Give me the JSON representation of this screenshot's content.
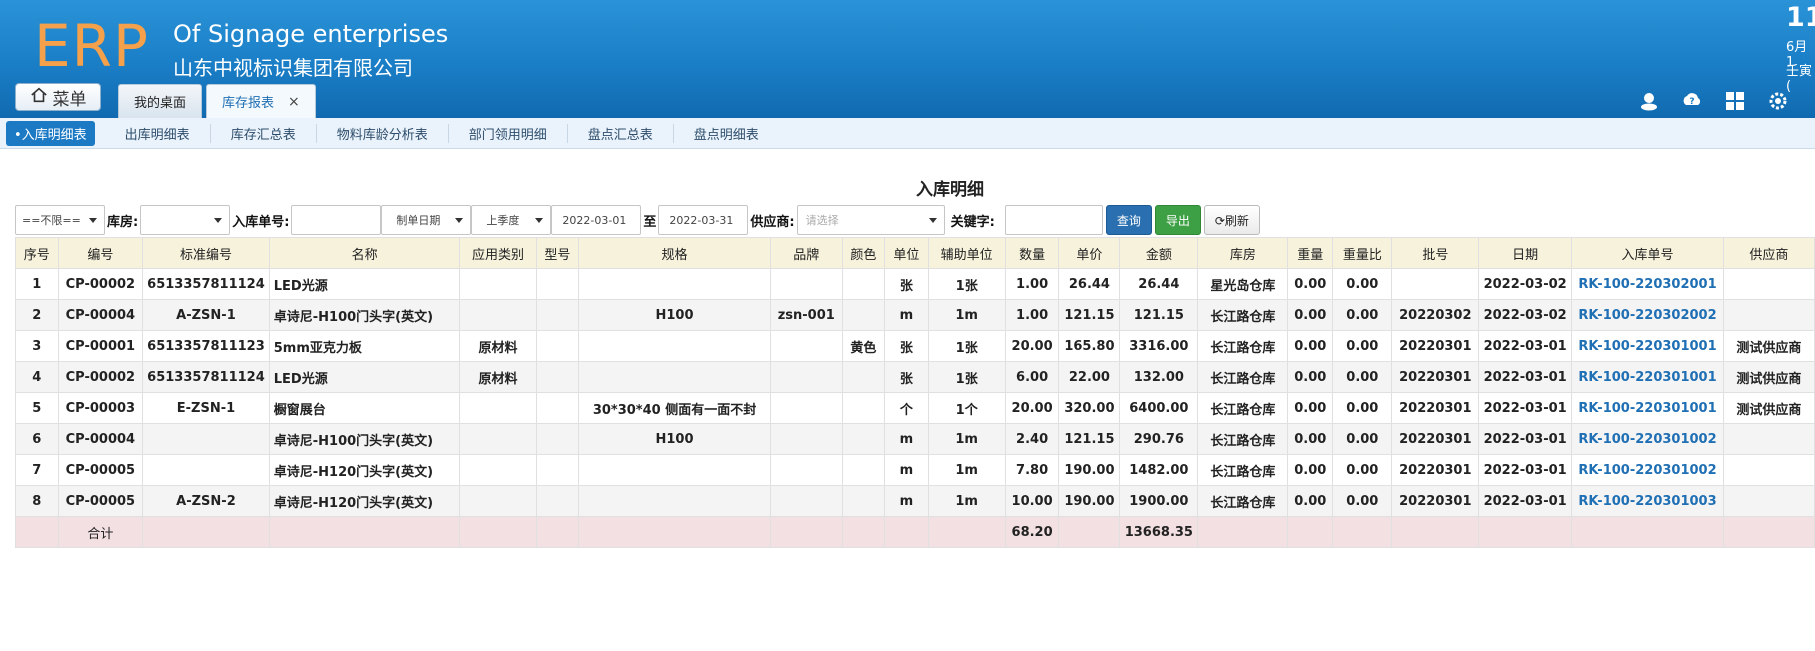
{
  "header": {
    "logo": "ERP",
    "company_en": "Of Signage enterprises",
    "company_cn": "山东中视标识集团有限公司",
    "clock_time": "11",
    "clock_date": "6月1",
    "clock_lunar": "壬寅("
  },
  "menu_button": {
    "label": "菜单",
    "icon": "home-icon"
  },
  "tabs": [
    {
      "label": "我的桌面"
    },
    {
      "label": "库存报表",
      "close": "×"
    }
  ],
  "header_icons": [
    "user-icon",
    "help-icon",
    "apps-icon",
    "settings-icon"
  ],
  "subnav": [
    "•入库明细表",
    "出库明细表",
    "库存汇总表",
    "物料库龄分析表",
    "部门领用明细",
    "盘点汇总表",
    "盘点明细表"
  ],
  "page_title": "入库明细",
  "filters": {
    "scope": "==不限==",
    "warehouse_label": "库房:",
    "warehouse_value": "",
    "order_no_label": "入库单号:",
    "order_no_value": "",
    "date_type": "制单日期",
    "period": "上季度",
    "date_from": "2022-03-01",
    "to_label": "至",
    "date_to": "2022-03-31",
    "supplier_label": "供应商:",
    "supplier_placeholder": "请选择",
    "keyword_label": "关键字:",
    "keyword_value": "",
    "query_button": "查询",
    "export_button": "导出",
    "refresh_button": "⟳刷新"
  },
  "table": {
    "columns": [
      "序号",
      "编号",
      "标准编号",
      "名称",
      "应用类别",
      "型号",
      "规格",
      "品牌",
      "颜色",
      "单位",
      "辅助单位",
      "数量",
      "单价",
      "金额",
      "库房",
      "重量",
      "重量比",
      "批号",
      "日期",
      "入库单号",
      "供应商"
    ],
    "rows": [
      [
        "1",
        "CP-00002",
        "6513357811124",
        "LED光源",
        "",
        "",
        "",
        "",
        "",
        "张",
        "1张",
        "1.00",
        "26.44",
        "26.44",
        "星光岛仓库",
        "0.00",
        "0.00",
        "",
        "2022-03-02",
        "RK-100-220302001",
        ""
      ],
      [
        "2",
        "CP-00004",
        "A-ZSN-1",
        "卓诗尼-H100门头字(英文)",
        "",
        "",
        "H100",
        "zsn-001",
        "",
        "m",
        "1m",
        "1.00",
        "121.15",
        "121.15",
        "长江路仓库",
        "0.00",
        "0.00",
        "20220302",
        "2022-03-02",
        "RK-100-220302002",
        ""
      ],
      [
        "3",
        "CP-00001",
        "6513357811123",
        "5mm亚克力板",
        "原材料",
        "",
        "",
        "",
        "黄色",
        "张",
        "1张",
        "20.00",
        "165.80",
        "3316.00",
        "长江路仓库",
        "0.00",
        "0.00",
        "20220301",
        "2022-03-01",
        "RK-100-220301001",
        "测试供应商"
      ],
      [
        "4",
        "CP-00002",
        "6513357811124",
        "LED光源",
        "原材料",
        "",
        "",
        "",
        "",
        "张",
        "1张",
        "6.00",
        "22.00",
        "132.00",
        "长江路仓库",
        "0.00",
        "0.00",
        "20220301",
        "2022-03-01",
        "RK-100-220301001",
        "测试供应商"
      ],
      [
        "5",
        "CP-00003",
        "E-ZSN-1",
        "橱窗展台",
        "",
        "",
        "30*30*40 侧面有一面不封",
        "",
        "",
        "个",
        "1个",
        "20.00",
        "320.00",
        "6400.00",
        "长江路仓库",
        "0.00",
        "0.00",
        "20220301",
        "2022-03-01",
        "RK-100-220301001",
        "测试供应商"
      ],
      [
        "6",
        "CP-00004",
        "",
        "卓诗尼-H100门头字(英文)",
        "",
        "",
        "H100",
        "",
        "",
        "m",
        "1m",
        "2.40",
        "121.15",
        "290.76",
        "长江路仓库",
        "0.00",
        "0.00",
        "20220301",
        "2022-03-01",
        "RK-100-220301002",
        ""
      ],
      [
        "7",
        "CP-00005",
        "",
        "卓诗尼-H120门头字(英文)",
        "",
        "",
        "",
        "",
        "",
        "m",
        "1m",
        "7.80",
        "190.00",
        "1482.00",
        "长江路仓库",
        "0.00",
        "0.00",
        "20220301",
        "2022-03-01",
        "RK-100-220301002",
        ""
      ],
      [
        "8",
        "CP-00005",
        "A-ZSN-2",
        "卓诗尼-H120门头字(英文)",
        "",
        "",
        "",
        "",
        "",
        "m",
        "1m",
        "10.00",
        "190.00",
        "1900.00",
        "长江路仓库",
        "0.00",
        "0.00",
        "20220301",
        "2022-03-01",
        "RK-100-220301003",
        ""
      ]
    ],
    "total": {
      "label": "合计",
      "quantity": "68.20",
      "amount": "13668.35"
    }
  }
}
